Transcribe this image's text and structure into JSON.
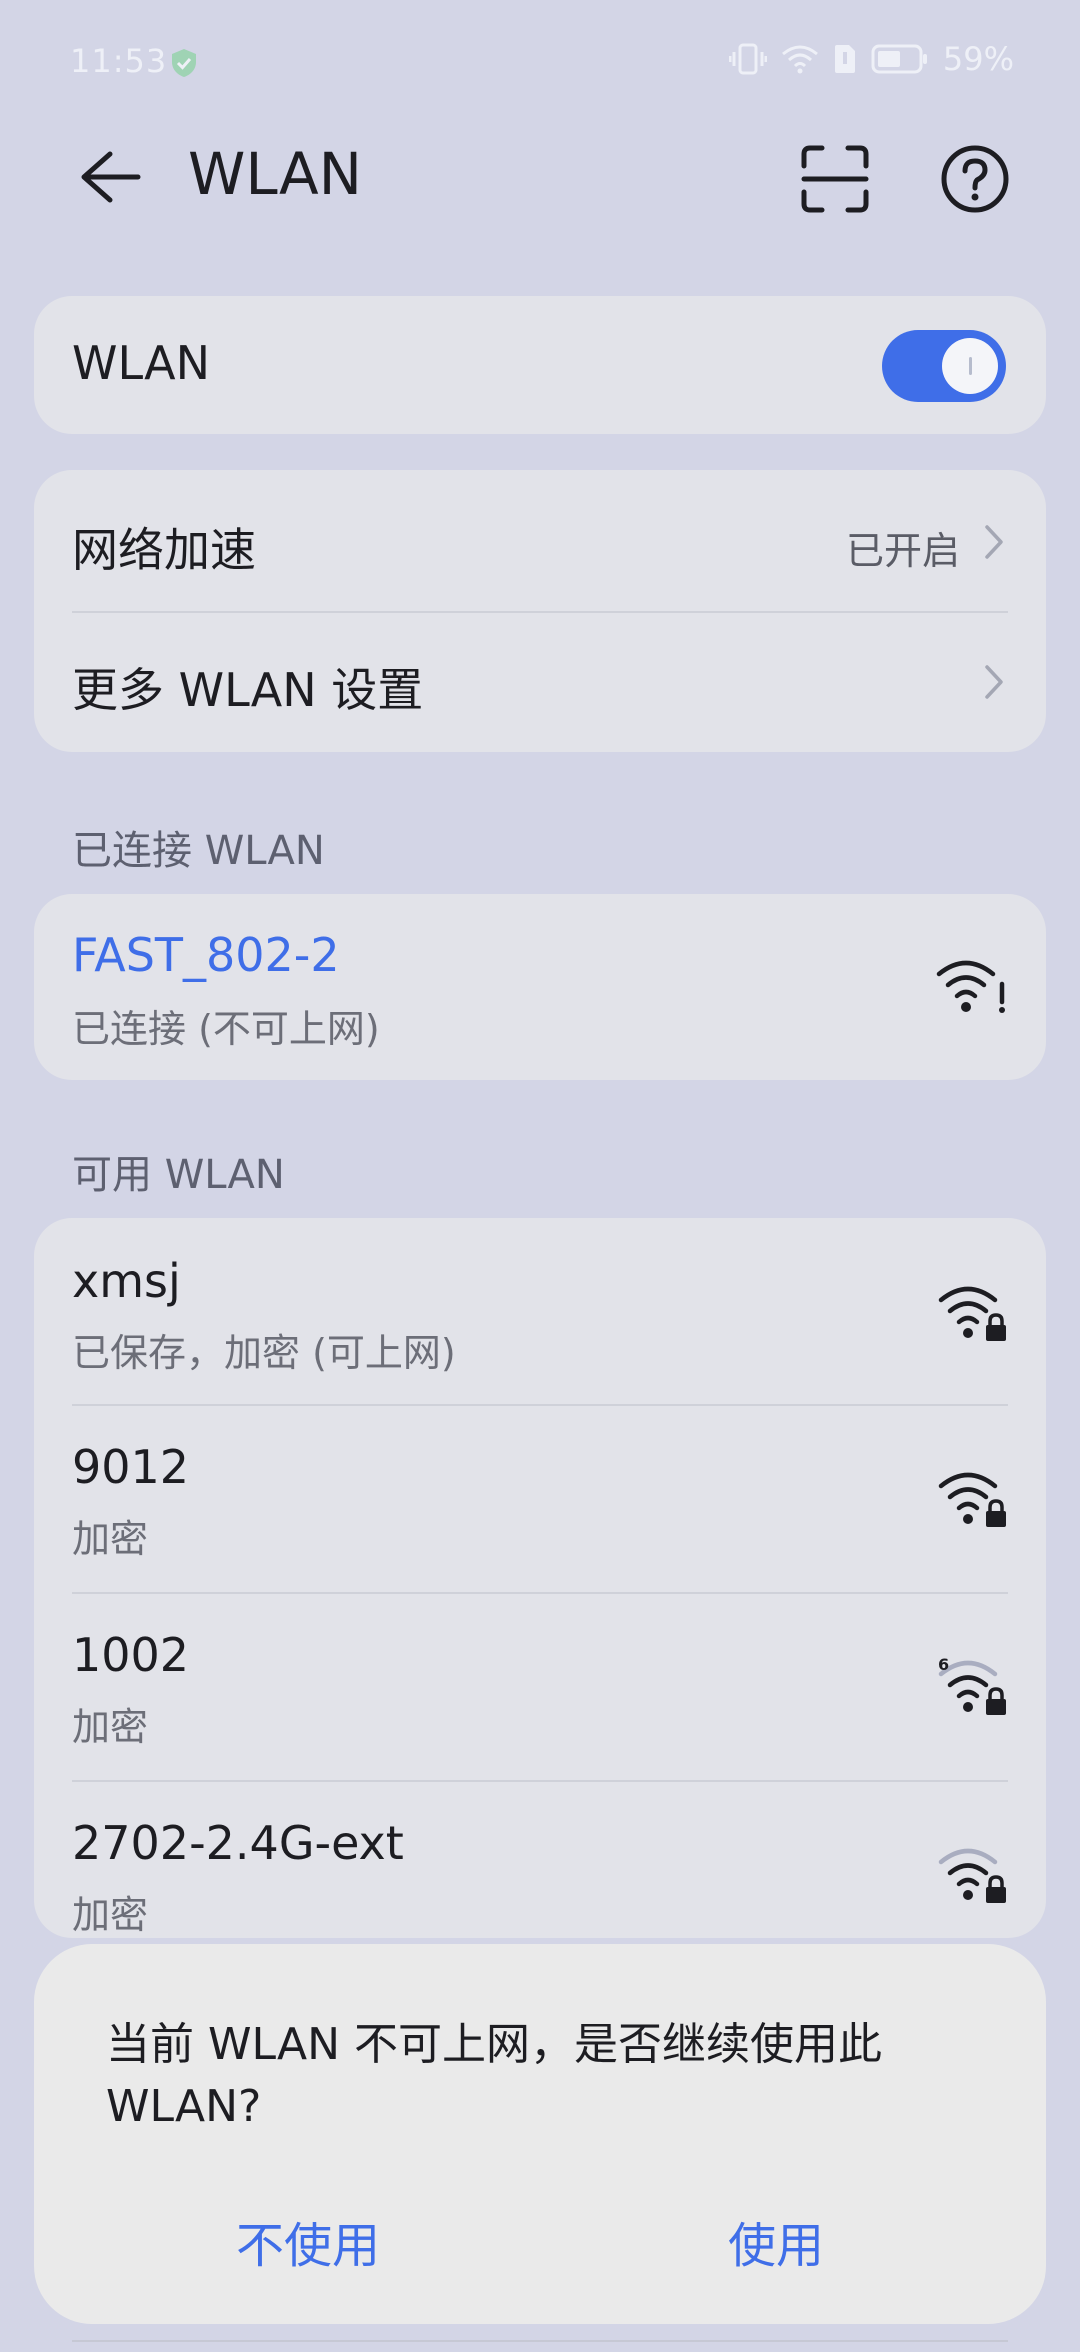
{
  "status_bar": {
    "time": "11:53",
    "battery": "59%"
  },
  "header": {
    "title": "WLAN"
  },
  "wlan_toggle": {
    "label": "WLAN",
    "state": "on"
  },
  "settings": {
    "acceleration": {
      "label": "网络加速",
      "value": "已开启"
    },
    "more": {
      "label": "更多 WLAN 设置"
    }
  },
  "connected": {
    "section_title": "已连接 WLAN",
    "network": {
      "name": "FAST_802-2",
      "status": "已连接 (不可上网)"
    }
  },
  "available": {
    "section_title": "可用 WLAN",
    "networks": [
      {
        "name": "xmsj",
        "status": "已保存，加密 (可上网)"
      },
      {
        "name": "9012",
        "status": "加密"
      },
      {
        "name": "1002",
        "status": "加密",
        "badge": "6"
      },
      {
        "name": "2702-2.4G-ext",
        "status": "加密"
      }
    ]
  },
  "dialog": {
    "message": "当前 WLAN 不可上网，是否继续使用此 WLAN?",
    "cancel_label": "不使用",
    "confirm_label": "使用"
  },
  "colors": {
    "accent": "#3f6ee8",
    "background": "#d3d5e6",
    "card": "#e2e3e9"
  }
}
